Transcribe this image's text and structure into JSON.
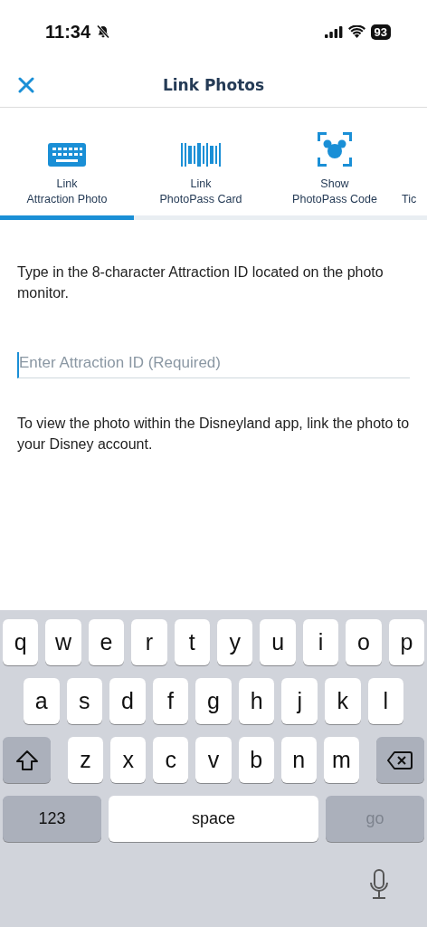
{
  "status_bar": {
    "time": "11:34",
    "silent": true,
    "battery": "93"
  },
  "header": {
    "title": "Link Photos"
  },
  "tabs": [
    {
      "kind": "keyboard",
      "line1": "Link",
      "line2": "Attraction Photo",
      "selected": true
    },
    {
      "kind": "barcode",
      "line1": "Link",
      "line2": "PhotoPass Card",
      "selected": false
    },
    {
      "kind": "scan",
      "line1": "Show",
      "line2": "PhotoPass Code",
      "selected": false
    },
    {
      "kind": "cut",
      "line2": "Tic",
      "selected": false
    }
  ],
  "instructions": "Type in the 8-character Attraction ID located on the photo monitor.",
  "attraction_field": {
    "placeholder": "Enter Attraction ID (Required)"
  },
  "note": "To view the photo within the Disneyland app, link the photo to your Disney account.",
  "keyboard": {
    "rows": [
      {
        "keys": [
          {
            "kind": "letter",
            "label": "q"
          },
          {
            "kind": "letter",
            "label": "w"
          },
          {
            "kind": "letter",
            "label": "e"
          },
          {
            "kind": "letter",
            "label": "r"
          },
          {
            "kind": "letter",
            "label": "t"
          },
          {
            "kind": "letter",
            "label": "y"
          },
          {
            "kind": "letter",
            "label": "u"
          },
          {
            "kind": "letter",
            "label": "i"
          },
          {
            "kind": "letter",
            "label": "o"
          },
          {
            "kind": "letter",
            "label": "p"
          }
        ]
      },
      {
        "keys": [
          {
            "kind": "letter",
            "label": "a"
          },
          {
            "kind": "letter",
            "label": "s"
          },
          {
            "kind": "letter",
            "label": "d"
          },
          {
            "kind": "letter",
            "label": "f"
          },
          {
            "kind": "letter",
            "label": "g"
          },
          {
            "kind": "letter",
            "label": "h"
          },
          {
            "kind": "letter",
            "label": "j"
          },
          {
            "kind": "letter",
            "label": "k"
          },
          {
            "kind": "letter",
            "label": "l"
          }
        ]
      },
      {
        "keys": [
          {
            "kind": "shift"
          },
          {
            "kind": "letter",
            "label": "z"
          },
          {
            "kind": "letter",
            "label": "x"
          },
          {
            "kind": "letter",
            "label": "c"
          },
          {
            "kind": "letter",
            "label": "v"
          },
          {
            "kind": "letter",
            "label": "b"
          },
          {
            "kind": "letter",
            "label": "n"
          },
          {
            "kind": "letter",
            "label": "m"
          },
          {
            "kind": "delete"
          }
        ]
      },
      {
        "keys": [
          {
            "kind": "mode",
            "label": "123"
          },
          {
            "kind": "space",
            "label": "space"
          },
          {
            "kind": "action",
            "label": "go",
            "disabled": true
          }
        ]
      }
    ]
  }
}
